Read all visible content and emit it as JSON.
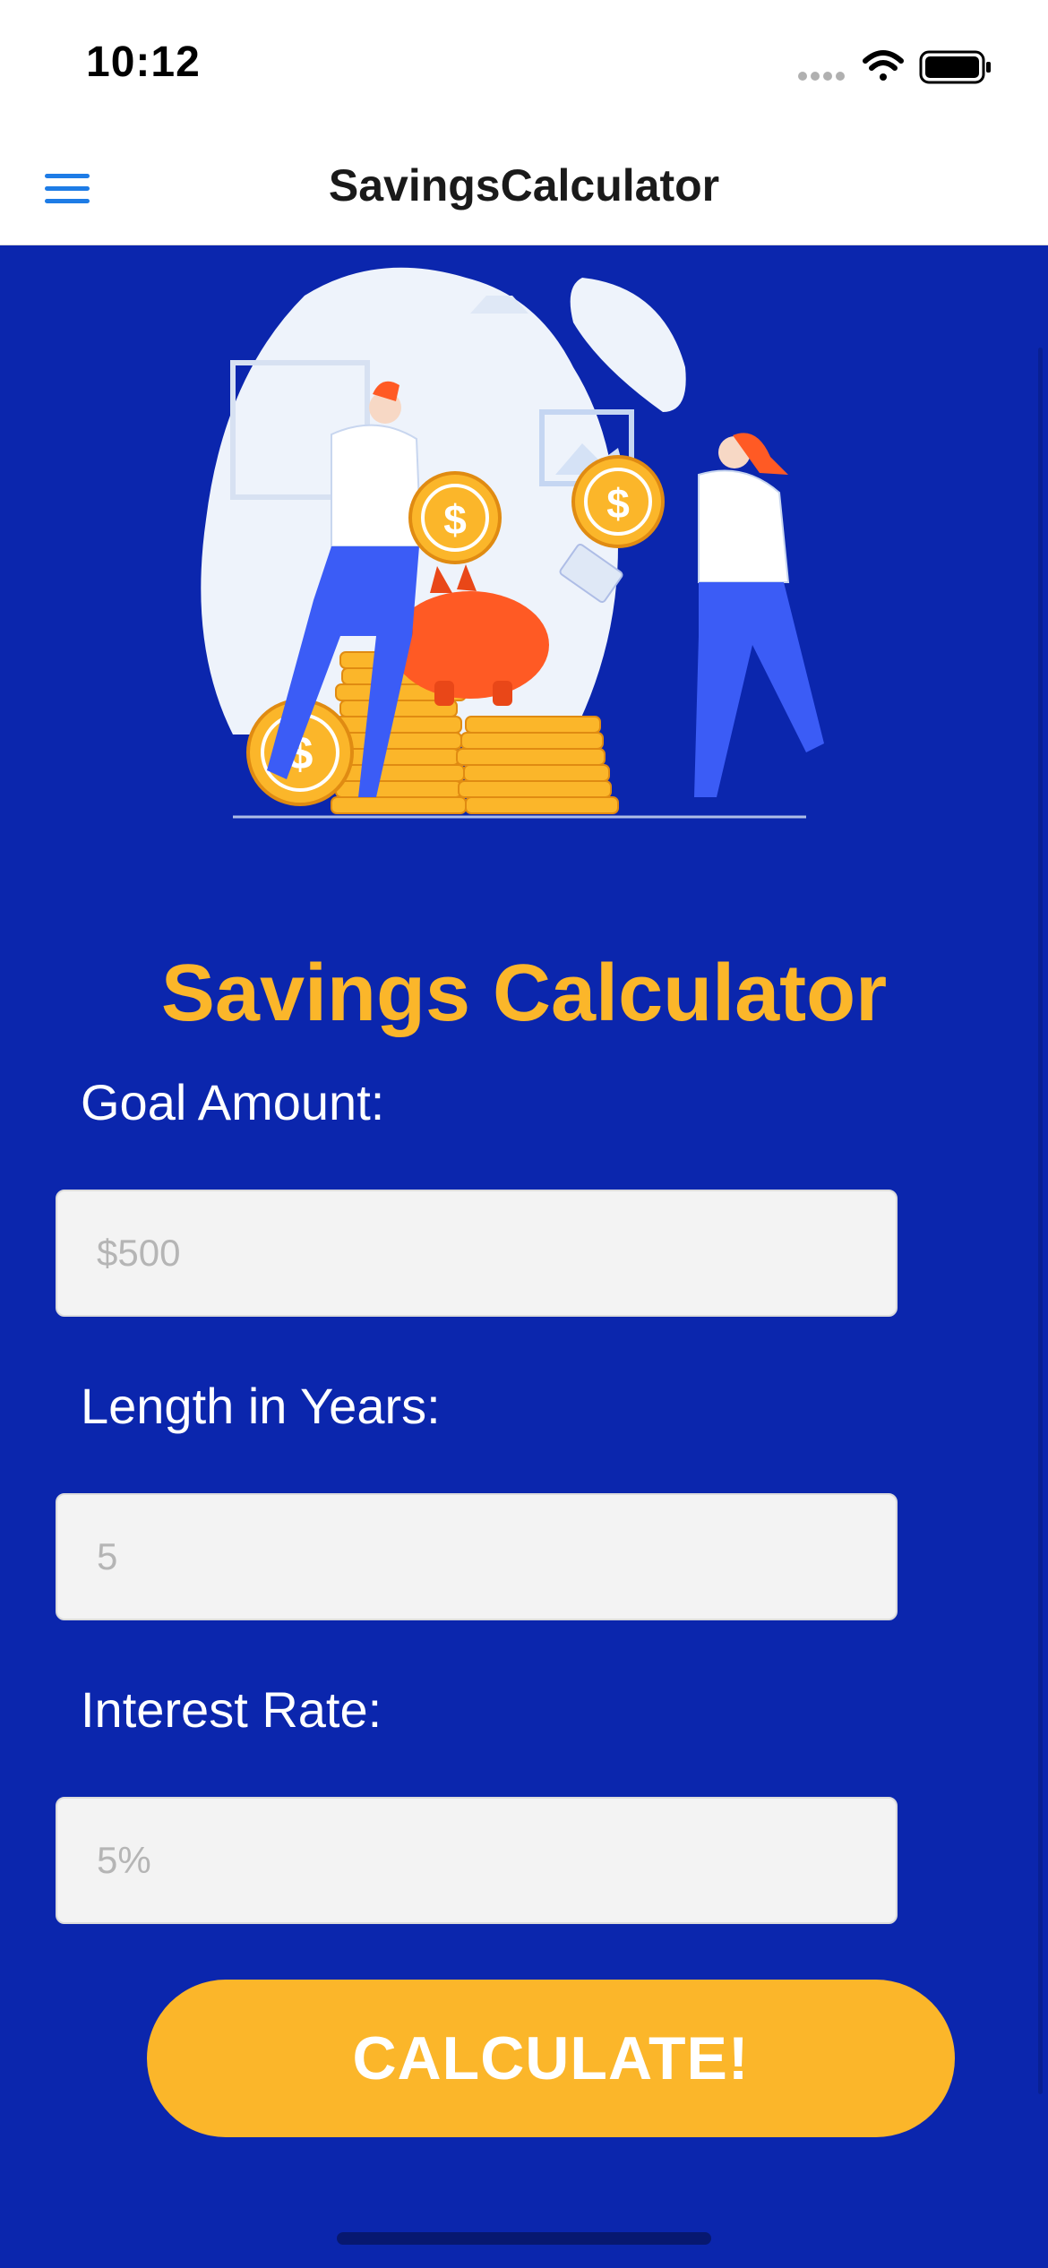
{
  "status_bar": {
    "time": "10:12",
    "icons": [
      "signal-dots-icon",
      "wifi-icon",
      "battery-icon"
    ]
  },
  "nav": {
    "title": "SavingsCalculator",
    "menu_icon": "hamburger-menu-icon"
  },
  "hero": {
    "illustration": "couple-saving-coins-piggy-bank-illustration"
  },
  "form": {
    "title": "Savings Calculator",
    "goal": {
      "label": "Goal Amount:",
      "placeholder": "$500",
      "value": ""
    },
    "years": {
      "label": "Length in Years:",
      "placeholder": "5",
      "value": ""
    },
    "rate": {
      "label": "Interest Rate:",
      "placeholder": "5%",
      "value": ""
    },
    "calculate_label": "CALCULATE!"
  },
  "colors": {
    "background": "#0b26ad",
    "accent": "#fbb62a",
    "menu_icon": "#1e7ce6",
    "input_bg": "#f3f3f3"
  }
}
